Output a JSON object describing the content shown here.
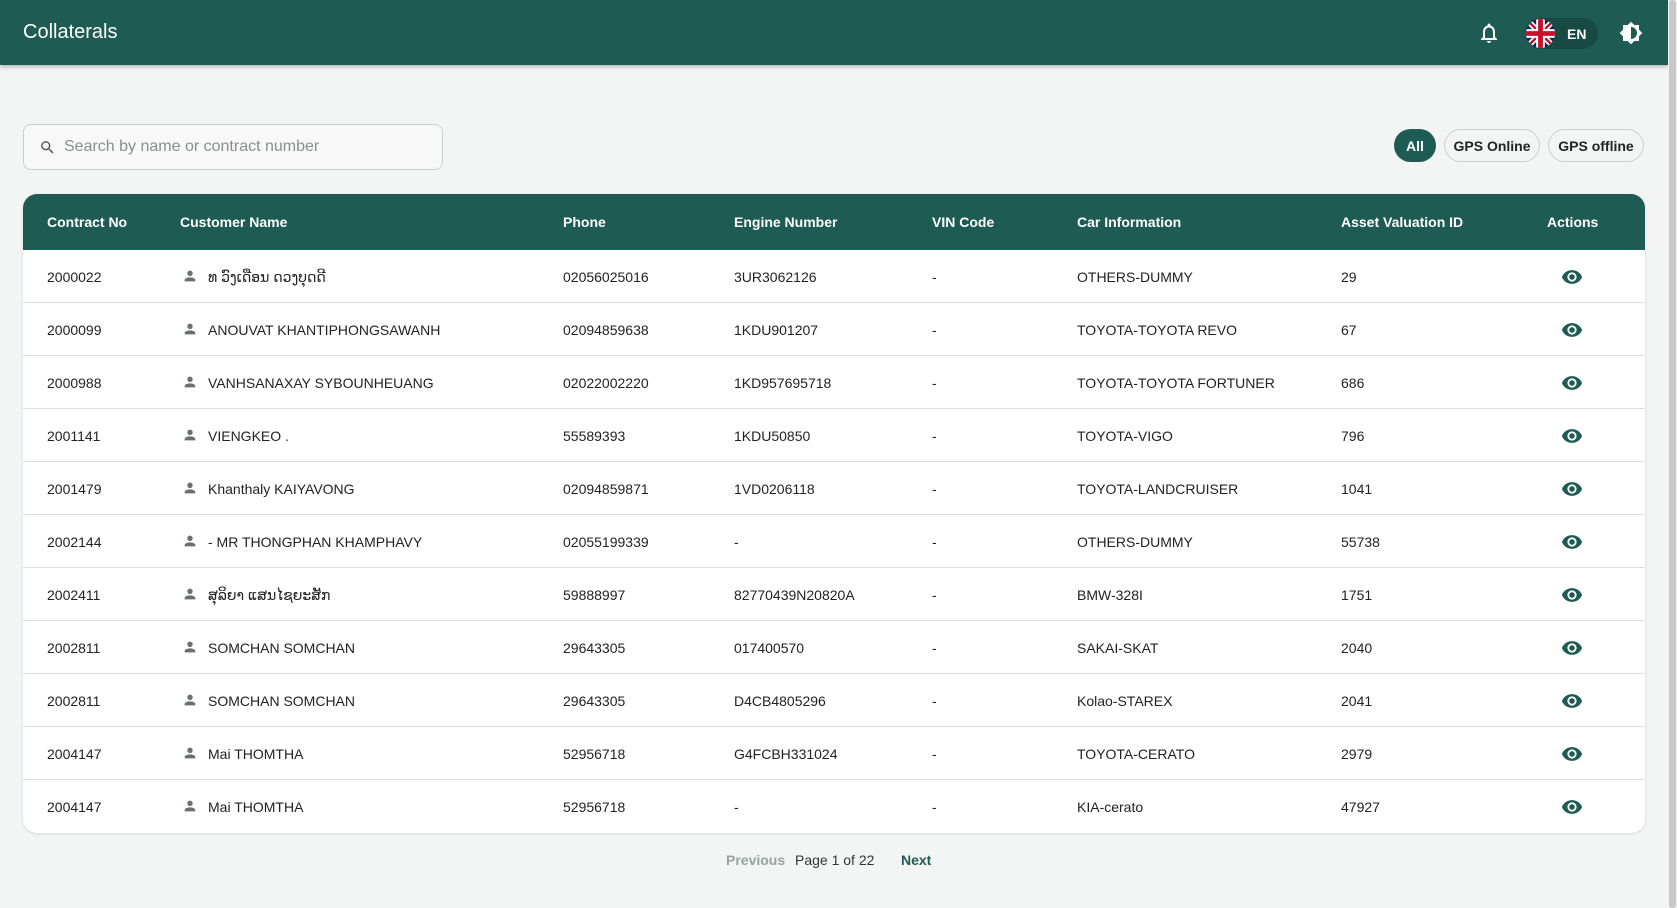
{
  "header": {
    "title": "Collaterals",
    "bell_icon": "bell-icon",
    "language_code": "EN",
    "flag_icon": "uk-flag-icon",
    "theme_icon": "brightness-icon"
  },
  "search": {
    "placeholder": "Search by name or contract number",
    "value": ""
  },
  "filters": {
    "all": "All",
    "gps_online": "GPS Online",
    "gps_offline": "GPS offline",
    "selected": "All"
  },
  "colors": {
    "primary": "#1e5b52",
    "background": "#f3f5f4"
  },
  "table": {
    "columns": [
      "Contract No",
      "Customer Name",
      "Phone",
      "Engine Number",
      "VIN Code",
      "Car Information",
      "Asset Valuation ID",
      "Actions"
    ],
    "rows": [
      {
        "contract": "2000022",
        "customer": "ທ ວົງເດືອນ ດວງບຸດດີ",
        "phone": "02056025016",
        "engine": "3UR3062126",
        "vin": "-",
        "car": "OTHERS-DUMMY",
        "asset_id": "29"
      },
      {
        "contract": "2000099",
        "customer": "ANOUVAT KHANTIPHONGSAWANH",
        "phone": "02094859638",
        "engine": "1KDU901207",
        "vin": "-",
        "car": "TOYOTA-TOYOTA REVO",
        "asset_id": "67"
      },
      {
        "contract": "2000988",
        "customer": "VANHSANAXAY SYBOUNHEUANG",
        "phone": "02022002220",
        "engine": "1KD957695718",
        "vin": "-",
        "car": "TOYOTA-TOYOTA FORTUNER",
        "asset_id": "686"
      },
      {
        "contract": "2001141",
        "customer": "VIENGKEO .",
        "phone": "55589393",
        "engine": "1KDU50850",
        "vin": "-",
        "car": "TOYOTA-VIGO",
        "asset_id": "796"
      },
      {
        "contract": "2001479",
        "customer": "Khanthaly KAIYAVONG",
        "phone": "02094859871",
        "engine": "1VD0206118",
        "vin": "-",
        "car": "TOYOTA-LANDCRUISER",
        "asset_id": "1041"
      },
      {
        "contract": "2002144",
        "customer": "- MR THONGPHAN KHAMPHAVY",
        "phone": "02055199339",
        "engine": "-",
        "vin": "-",
        "car": "OTHERS-DUMMY",
        "asset_id": "55738"
      },
      {
        "contract": "2002411",
        "customer": "ສຸລິຍາ ແສນໄຊຍະສັກ",
        "phone": "59888997",
        "engine": "82770439N20820A",
        "vin": "-",
        "car": "BMW-328I",
        "asset_id": "1751"
      },
      {
        "contract": "2002811",
        "customer": "SOMCHAN SOMCHAN",
        "phone": "29643305",
        "engine": "017400570",
        "vin": "-",
        "car": "SAKAI-SKAT",
        "asset_id": "2040"
      },
      {
        "contract": "2002811",
        "customer": "SOMCHAN SOMCHAN",
        "phone": "29643305",
        "engine": "D4CB4805296",
        "vin": "-",
        "car": "Kolao-STAREX",
        "asset_id": "2041"
      },
      {
        "contract": "2004147",
        "customer": "Mai THOMTHA",
        "phone": "52956718",
        "engine": "G4FCBH331024",
        "vin": "-",
        "car": "TOYOTA-CERATO",
        "asset_id": "2979"
      },
      {
        "contract": "2004147",
        "customer": "Mai THOMTHA",
        "phone": "52956718",
        "engine": "-",
        "vin": "-",
        "car": "KIA-cerato",
        "asset_id": "47927"
      }
    ]
  },
  "pagination": {
    "previous": "Previous",
    "page_info": "Page 1 of 22",
    "next": "Next"
  }
}
